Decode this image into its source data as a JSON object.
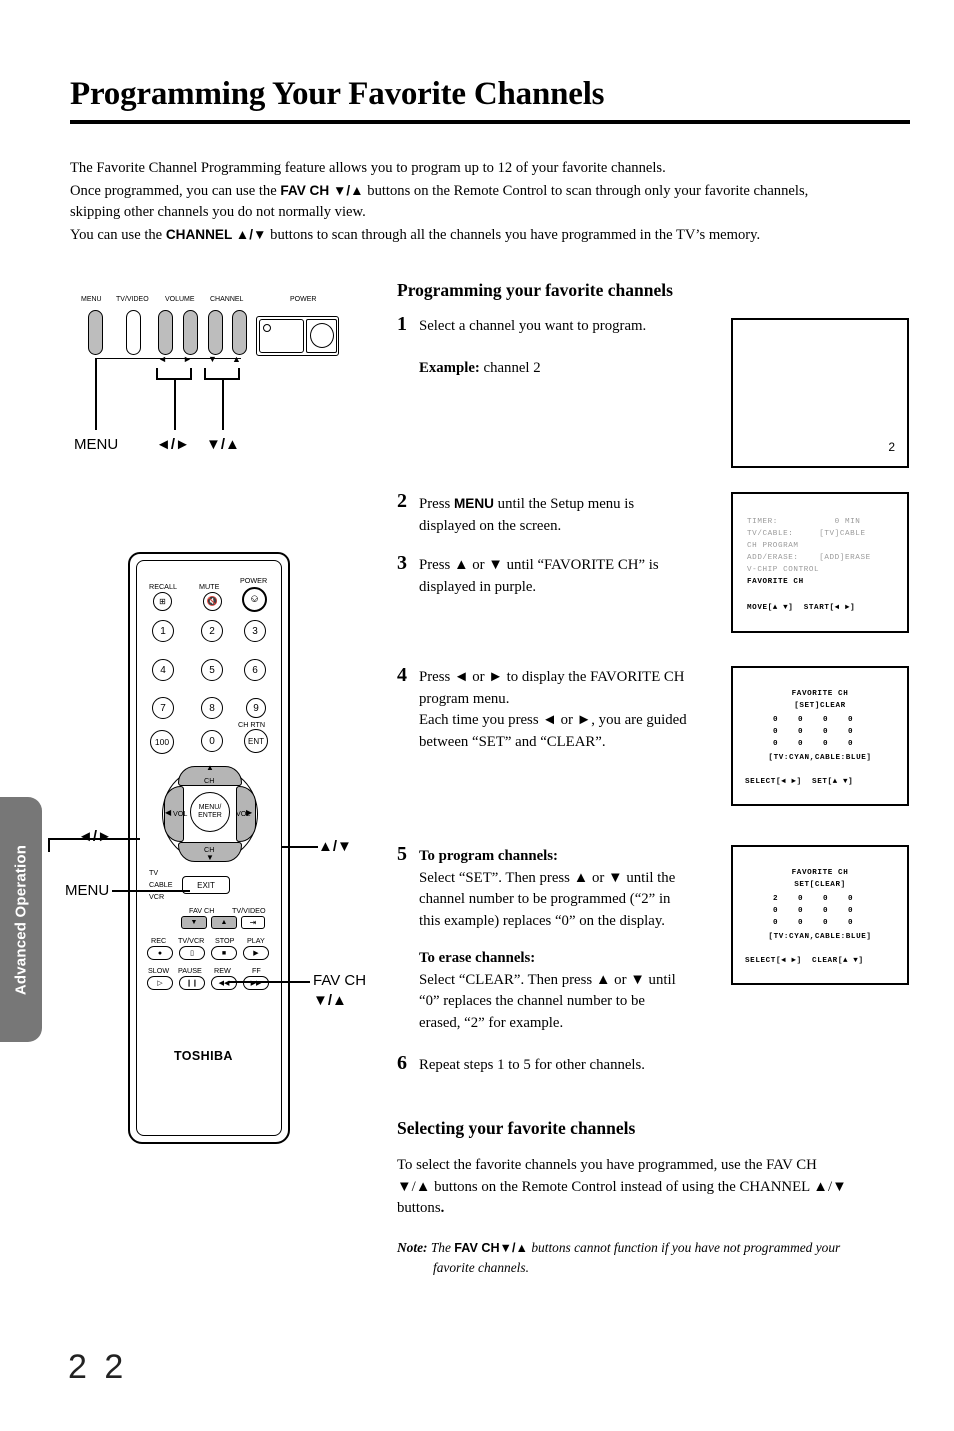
{
  "sidebar": {
    "tab_label": "Advanced Operation"
  },
  "header": {
    "title": "Programming Your Favorite Channels"
  },
  "intro": {
    "line1": "The Favorite Channel Programming feature allows you to program up to 12 of your favorite channels.",
    "line2_a": "Once programmed, you can use the ",
    "line2_b": "FAV CH ▼/▲",
    "line2_c": " buttons on the Remote Control to scan through only your favorite channels,",
    "line3": "skipping other channels you do not normally view.",
    "line4_a": "You can use the ",
    "line4_b": "CHANNEL ▲/▼",
    "line4_c": " buttons to scan through all the channels you have programmed in the TV’s memory."
  },
  "tv_panel": {
    "labels": [
      "MENU",
      "TV/VIDEO",
      "VOLUME",
      "CHANNEL",
      "POWER"
    ],
    "callouts": {
      "menu": "MENU",
      "volume": "◄/►",
      "channel": "▼/▲"
    },
    "arrows": {
      "left": "◄",
      "right": "►",
      "down": "▼",
      "up": "▲"
    }
  },
  "remote": {
    "brand": "TOSHIBA",
    "top_labels": {
      "recall": "RECALL",
      "mute": "MUTE",
      "power": "POWER"
    },
    "keypad": [
      "1",
      "2",
      "3",
      "4",
      "5",
      "6",
      "7",
      "8",
      "9",
      "100",
      "0",
      "ENT"
    ],
    "ch_rtn": "CH RTN",
    "pad": {
      "up_label": "CH",
      "down_label": "CH",
      "left_label": "VOL",
      "right_label": "VOL",
      "center_line1": "MENU/",
      "center_line2": "ENTER"
    },
    "source_labels": [
      "TV",
      "CABLE",
      "VCR"
    ],
    "exit": "EXIT",
    "fav_ch": "FAV CH",
    "tv_video": "TV/VIDEO",
    "vcr_row1": [
      "REC",
      "TV/VCR",
      "STOP",
      "PLAY"
    ],
    "vcr_row2": [
      "SLOW",
      "PAUSE",
      "REW",
      "FF"
    ],
    "callouts": {
      "volume": "◄/►",
      "menu": "MENU",
      "channel": "▲/▼",
      "fav_ch_line1": "FAV CH",
      "fav_ch_line2": "▼/▲"
    }
  },
  "main": {
    "section1_title": "Programming your favorite channels",
    "section2_title": "Selecting your favorite channels",
    "steps": [
      {
        "num": "1",
        "line1": "Select a channel you want to program.",
        "example_label": "Example:",
        "example_value": " channel 2"
      },
      {
        "num": "2",
        "line1_a": "Press ",
        "line1_b": "MENU",
        "line1_c": " until the Setup menu is",
        "line2": "displayed on the screen."
      },
      {
        "num": "3",
        "line1": "Press ▲ or ▼ until “FAVORITE CH” is",
        "line2": "displayed in purple."
      },
      {
        "num": "4",
        "line1": "Press ◄ or ► to display the FAVORITE CH",
        "line2": "program menu.",
        "line3": "Each time you press ◄ or ►, you are guided",
        "line4": "between “SET” and “CLEAR”."
      },
      {
        "num": "5",
        "sub1_title": "To program channels:",
        "sub1_l1": "Select “SET”. Then press ▲ or ▼ until the",
        "sub1_l2": "channel number to be programmed (“2” in",
        "sub1_l3": "this example) replaces “0” on the display.",
        "sub2_title": "To erase channels:",
        "sub2_l1": "Select “CLEAR”. Then press ▲ or ▼ until",
        "sub2_l2": "“0” replaces the channel number to be",
        "sub2_l3": "erased, “2” for example."
      },
      {
        "num": "6",
        "line1": "Repeat steps 1 to 5 for other channels."
      }
    ],
    "selecting": {
      "l1_a": "To select the favorite channels you have programmed, use the ",
      "l1_b": "FAV CH",
      "l2_a": "▼/▲",
      "l2_b": "  buttons on the Remote Control instead of using the ",
      "l2_c": "CHANNEL ▲/▼",
      "l3": "buttons",
      "l3_end": "."
    },
    "note": {
      "label": "Note:",
      "t1": " The ",
      "sans": "FAV CH▼/▲",
      "t2": " buttons cannot function if you have not programmed your",
      "t3": "favorite channels."
    }
  },
  "screens": {
    "screen1": {
      "channel": "2"
    },
    "screen2": {
      "rows": [
        "TIMER:           0 MIN",
        "TV/CABLE:     [TV]CABLE",
        "CH PROGRAM",
        "ADD/ERASE:    [ADD]ERASE",
        "V-CHIP CONTROL"
      ],
      "highlight": "FAVORITE CH",
      "footer": "MOVE[▲ ▼]  START[◄ ►]"
    },
    "screen3": {
      "title": "FAVORITE CH",
      "mode": "[SET]CLEAR",
      "grid": [
        [
          "0",
          "0",
          "0",
          "0"
        ],
        [
          "0",
          "0",
          "0",
          "0"
        ],
        [
          "0",
          "0",
          "0",
          "0"
        ]
      ],
      "legend": "[TV:CYAN,CABLE:BLUE]",
      "footer": "SELECT[◄ ►]  SET[▲ ▼]"
    },
    "screen4": {
      "title": "FAVORITE CH",
      "mode": "SET[CLEAR]",
      "grid": [
        [
          "2",
          "0",
          "0",
          "0"
        ],
        [
          "0",
          "0",
          "0",
          "0"
        ],
        [
          "0",
          "0",
          "0",
          "0"
        ]
      ],
      "legend": "[TV:CYAN,CABLE:BLUE]",
      "footer": "SELECT[◄ ►]  CLEAR[▲ ▼]"
    }
  },
  "footer": {
    "page_number": "2 2"
  }
}
